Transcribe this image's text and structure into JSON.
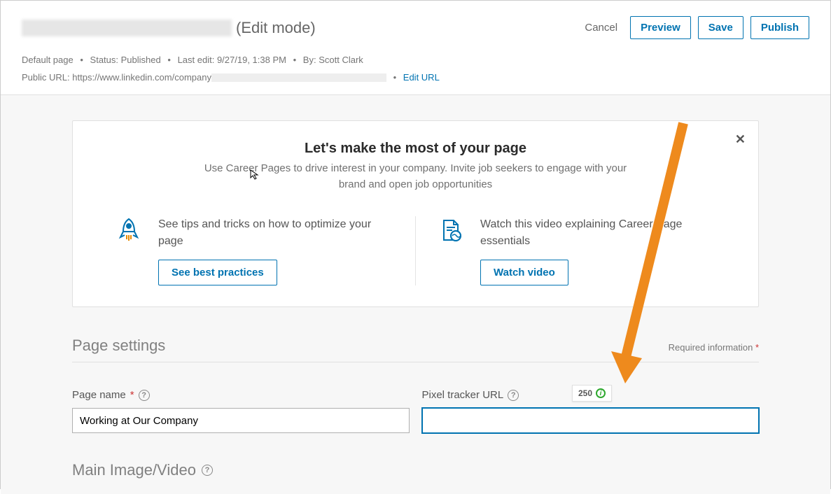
{
  "header": {
    "edit_mode": "(Edit mode)",
    "cancel": "Cancel",
    "preview": "Preview",
    "save": "Save",
    "publish": "Publish"
  },
  "meta": {
    "default_page": "Default page",
    "status_label": "Status:",
    "status_value": "Published",
    "last_edit_label": "Last edit:",
    "last_edit_value": "9/27/19, 1:38 PM",
    "by_label": "By:",
    "by_value": "Scott Clark",
    "public_url_label": "Public URL:",
    "public_url_value": "https://www.linkedin.com/company",
    "edit_url": "Edit URL"
  },
  "promo": {
    "title": "Let's make the most of your page",
    "subtitle": "Use Career Pages to drive interest in your company. Invite job seekers to engage with your brand and open job opportunities",
    "tips_text": "See tips and tricks on how to optimize your page",
    "tips_button": "See best practices",
    "video_text": "Watch this video explaining Career Page essentials",
    "video_button": "Watch video"
  },
  "settings": {
    "title": "Page settings",
    "required": "Required information",
    "page_name_label": "Page name",
    "page_name_value": "Working at Our Company",
    "pixel_label": "Pixel tracker URL",
    "pixel_value": "",
    "char_badge": "250"
  },
  "main_img": {
    "title": "Main Image/Video"
  }
}
